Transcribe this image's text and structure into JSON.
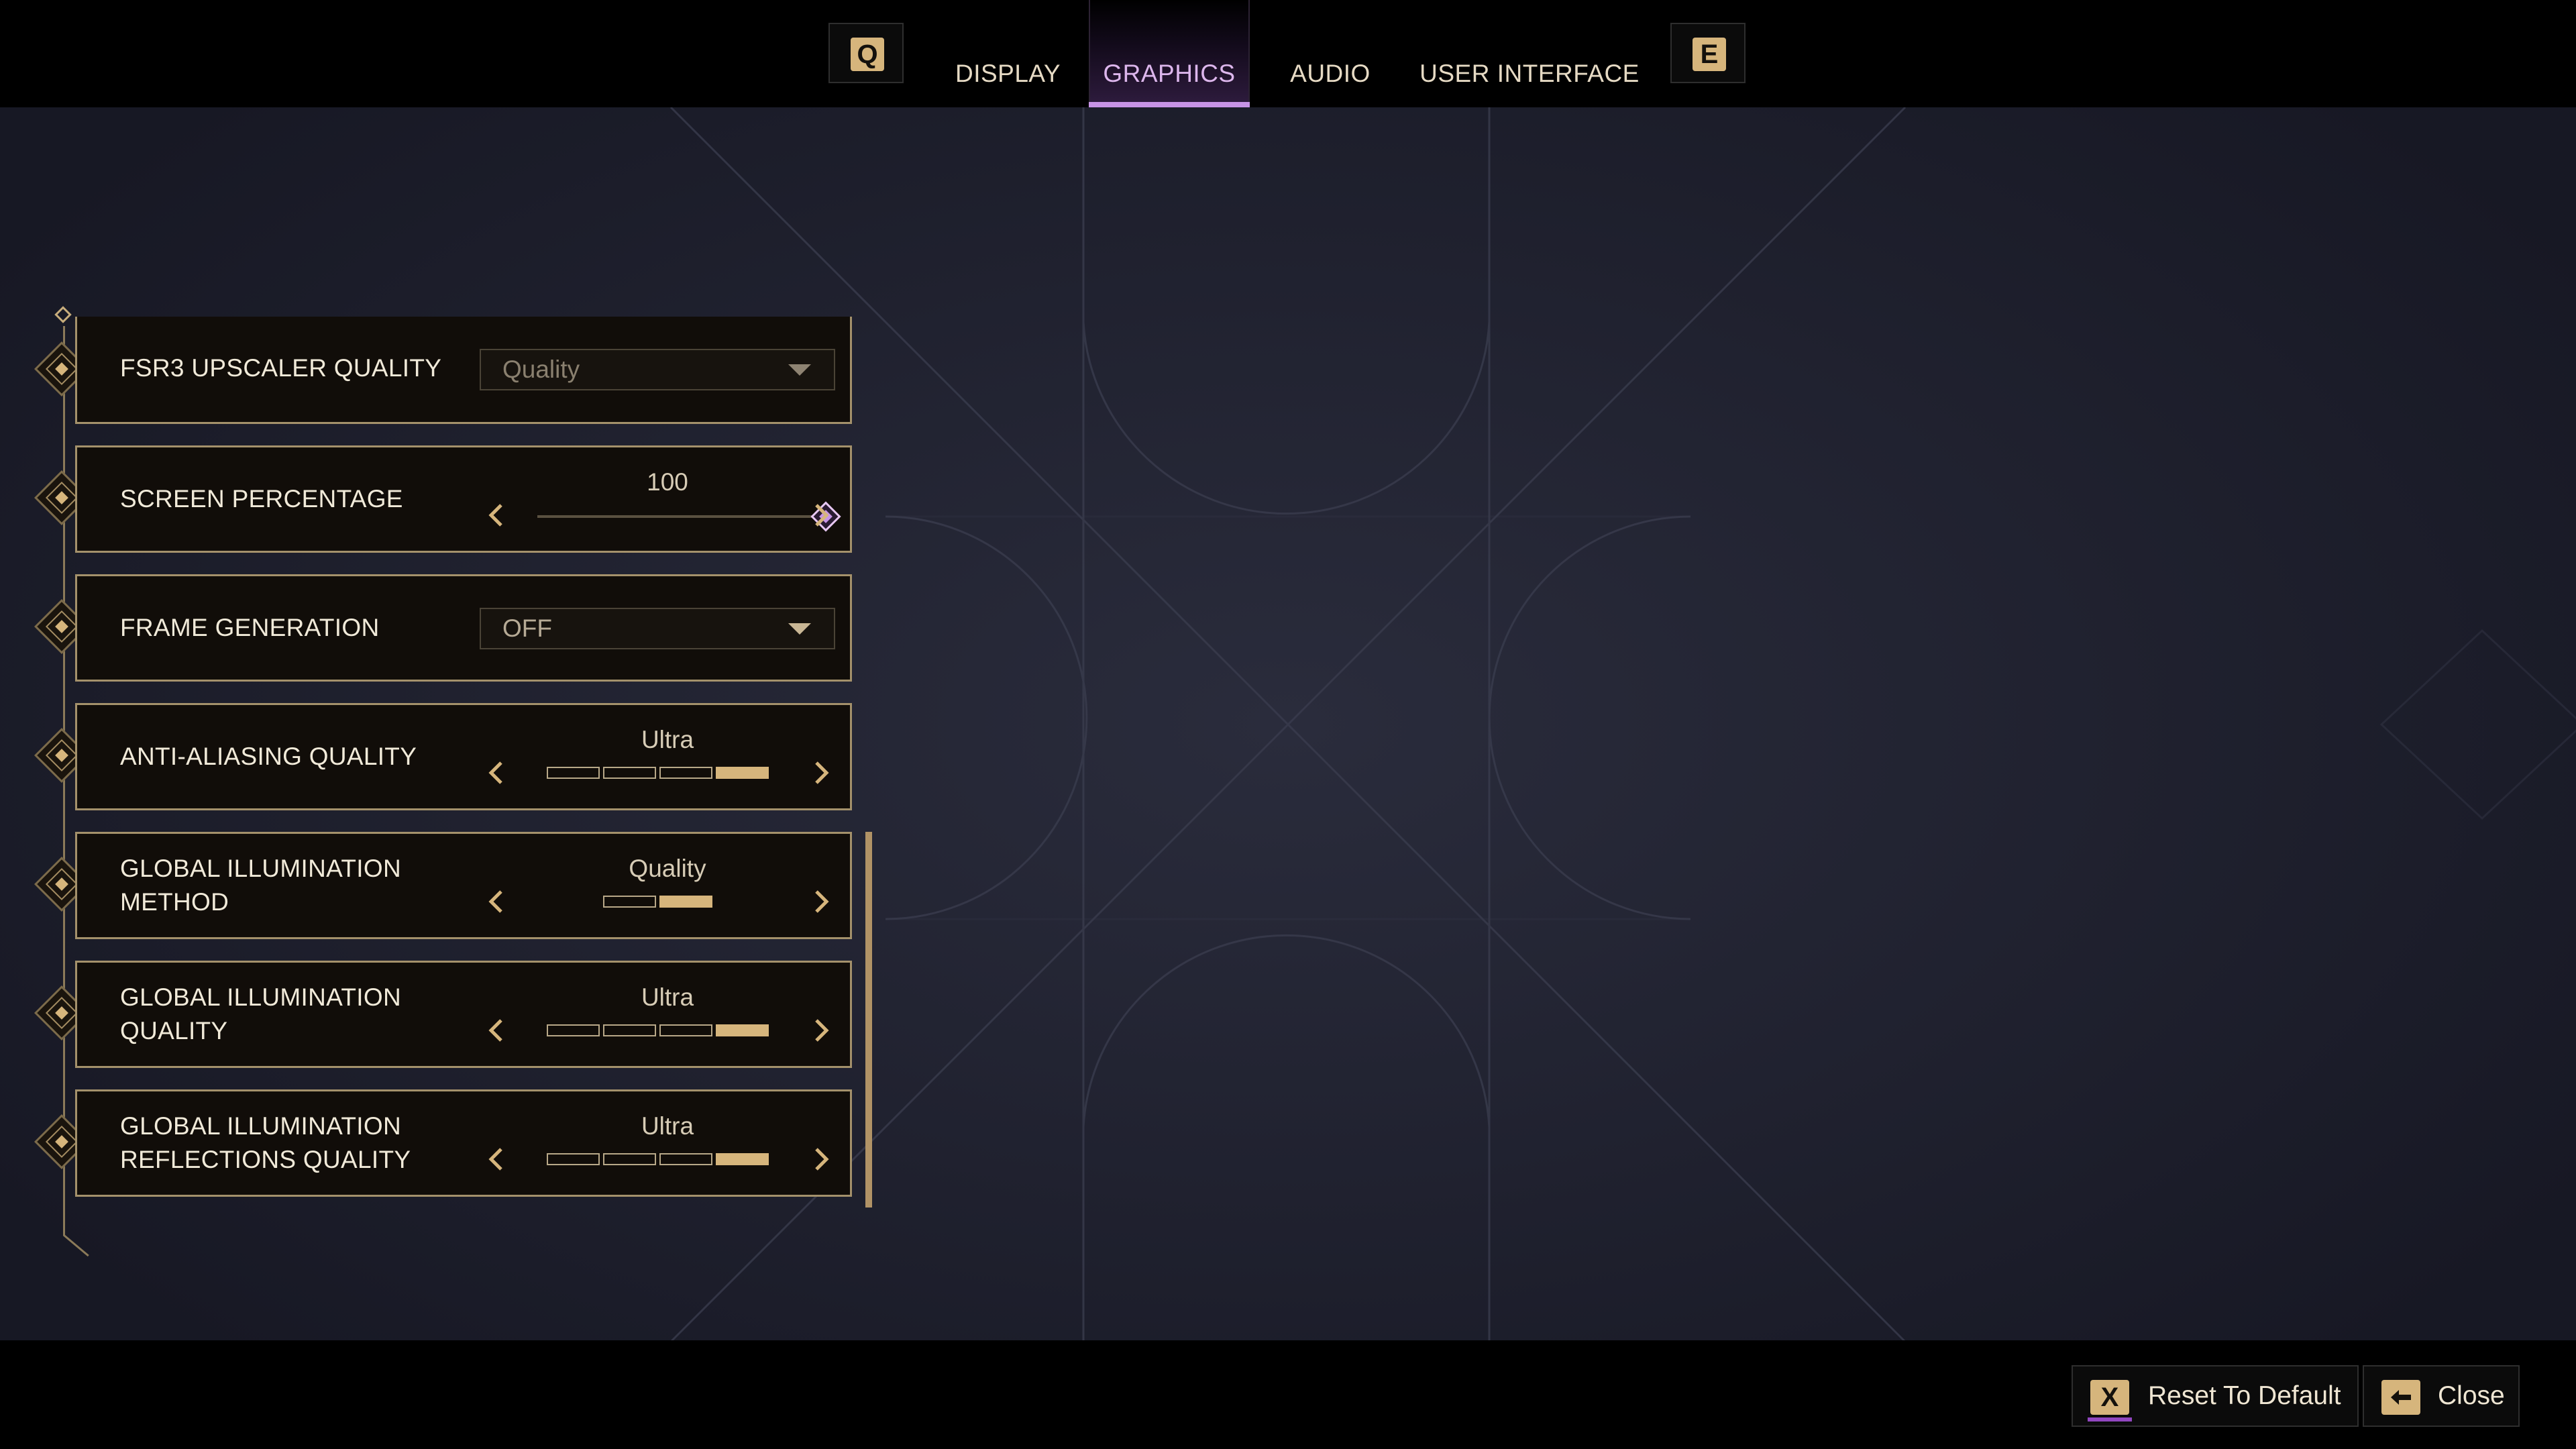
{
  "nav": {
    "prev_key": "Q",
    "next_key": "E",
    "tabs": [
      {
        "label": "DISPLAY",
        "active": false
      },
      {
        "label": "GRAPHICS",
        "active": true
      },
      {
        "label": "AUDIO",
        "active": false
      },
      {
        "label": "USER INTERFACE",
        "active": false
      }
    ]
  },
  "settings": [
    {
      "label": "FSR3 UPSCALER QUALITY",
      "control": "dropdown",
      "value": "Quality",
      "disabled": true
    },
    {
      "label": "SCREEN PERCENTAGE",
      "control": "slider",
      "value": "100",
      "fraction": 1.0
    },
    {
      "label": "FRAME GENERATION",
      "control": "dropdown",
      "value": "OFF",
      "disabled": false
    },
    {
      "label": "ANTI-ALIASING QUALITY",
      "control": "stepper",
      "value": "Ultra",
      "level": 4,
      "levels": 4
    },
    {
      "label_lines": [
        "GLOBAL ILLUMINATION",
        "METHOD"
      ],
      "control": "stepper",
      "value": "Quality",
      "level": 2,
      "levels": 2
    },
    {
      "label_lines": [
        "GLOBAL ILLUMINATION",
        "QUALITY"
      ],
      "control": "stepper",
      "value": "Ultra",
      "level": 4,
      "levels": 4
    },
    {
      "label_lines": [
        "GLOBAL ILLUMINATION",
        "REFLECTIONS QUALITY"
      ],
      "control": "stepper",
      "value": "Ultra",
      "level": 4,
      "levels": 4
    }
  ],
  "footer": {
    "reset": {
      "key": "X",
      "label": "Reset To Default"
    },
    "close": {
      "icon": "back-arrow-icon",
      "label": "Close"
    }
  },
  "colors": {
    "accent_gold": "#d6b57c",
    "accent_purple": "#c794e6",
    "background": "#1b1c29"
  }
}
